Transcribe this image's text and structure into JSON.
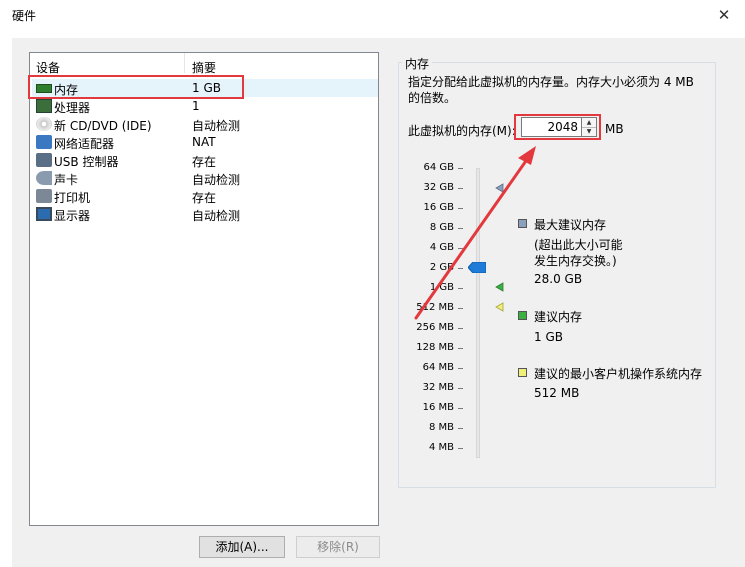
{
  "window": {
    "title": "硬件",
    "close_glyph": "✕"
  },
  "device_list": {
    "columns": [
      "设备",
      "摘要"
    ],
    "items": [
      {
        "name": "内存",
        "summary": "1 GB",
        "icon": "memory-icon",
        "selected": true
      },
      {
        "name": "处理器",
        "summary": "1",
        "icon": "processor-icon"
      },
      {
        "name": "新 CD/DVD (IDE)",
        "summary": "自动检测",
        "icon": "cd-dvd-icon"
      },
      {
        "name": "网络适配器",
        "summary": "NAT",
        "icon": "network-adapter-icon"
      },
      {
        "name": "USB 控制器",
        "summary": "存在",
        "icon": "usb-icon"
      },
      {
        "name": "声卡",
        "summary": "自动检测",
        "icon": "sound-card-icon"
      },
      {
        "name": "打印机",
        "summary": "存在",
        "icon": "printer-icon"
      },
      {
        "name": "显示器",
        "summary": "自动检测",
        "icon": "display-icon"
      }
    ]
  },
  "buttons": {
    "add": "添加(A)...",
    "remove": "移除(R)"
  },
  "memory_panel": {
    "title": "内存",
    "description": "指定分配给此虚拟机的内存量。内存大小必须为 4 MB 的倍数。",
    "field_label": "此虚拟机的内存(M):",
    "value": "2048",
    "unit": "MB",
    "scale_labels": [
      "64 GB",
      "32 GB",
      "16 GB",
      "8 GB",
      "4 GB",
      "2 GB",
      "1 GB",
      "512 MB",
      "256 MB",
      "128 MB",
      "64 MB",
      "32 MB",
      "16 MB",
      "8 MB",
      "4 MB"
    ],
    "legend": {
      "max_title": "最大建议内存",
      "max_note_line1": "(超出此大小可能",
      "max_note_line2": "发生内存交换。)",
      "max_value": "28.0 GB",
      "rec_title": "建议内存",
      "rec_value": "1 GB",
      "min_title": "建议的最小客户机操作系统内存",
      "min_value": "512 MB"
    },
    "colors": {
      "max": "#8aa0bd",
      "recommended": "#3cb043",
      "minimum": "#f0ef7a",
      "thumb": "#1e7bd8",
      "annotation": "#e3383d"
    }
  }
}
